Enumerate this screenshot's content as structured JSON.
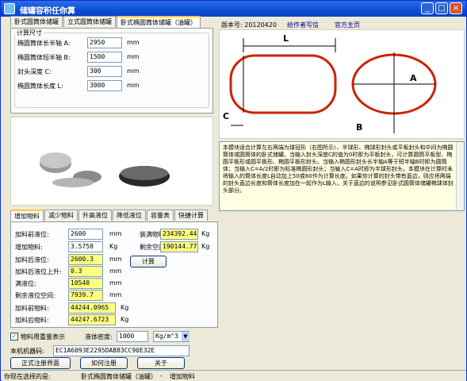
{
  "window": {
    "title": "储罐容积任你算"
  },
  "titlebar_buttons": {
    "minimize": "_",
    "maximize": "□",
    "close": "×"
  },
  "top_tabs": [
    "卧式圆筒体储罐",
    "立式圆筒体储罐",
    "卧式椭圆筒体储罐（油罐）"
  ],
  "calc": {
    "legend": "计算尺寸",
    "rows": [
      {
        "label": "椭圆筒体长半轴 A:",
        "value": "2950",
        "unit": "mm"
      },
      {
        "label": "椭圆筒体短半轴 B:",
        "value": "1500",
        "unit": "mm"
      },
      {
        "label": "封头深度 C:",
        "value": "300",
        "unit": "mm"
      },
      {
        "label": "椭圆筒体长度 L:",
        "value": "3000",
        "unit": "mm"
      }
    ]
  },
  "header": {
    "version": "版本号: 20120420",
    "link_feedback": "给作者写信",
    "link_home": "官方主页"
  },
  "diagram": {
    "label_L": "L",
    "label_C": "C",
    "label_A": "A",
    "label_B": "B"
  },
  "description": "本模块适合计算左右两端为球冠形（右图所示）、半球形、椭球形封头或平板封头和中间为椭圆筒体或圆筒体的卧式储罐。当输入封头深度C的值为0时即为平板封头，可计算圆筒平板型、椭圆平板形或圆平板形、椭圆平板形封头。当输入椭圆形封头长半轴A等于短半轴B时即为圆筒体；当输入C=A/2时即为标准椭圆形封头；当输入C=A时即为半球形封头。本模块在计算时未将输入的筒体长度L自动加上50或80作为计算长度。如果你计算的封头带有直边，则应将两端的封头直边长度和筒体长度加在一起作为L输入，关于直边的说明参见卧式圆筒体储罐椭球体封头部分。",
  "bottom_tabs": [
    "增加物料",
    "减少物料",
    "升高液位",
    "降低液位",
    "容量表",
    "快捷计算"
  ],
  "add": {
    "before_level": {
      "label": "加料前液位:",
      "value": "2600",
      "unit": "mm"
    },
    "add_amount": {
      "label": "增加物料:",
      "value": "3.5758",
      "unit": "Kg"
    },
    "after_level": {
      "label": "加料后液位:",
      "value": "2600.3",
      "unit": "mm"
    },
    "level_rise": {
      "label": "加料后液位上升:",
      "value": "0.3",
      "unit": "mm"
    },
    "full_level": {
      "label": "满液位:",
      "value": "10540",
      "unit": "mm"
    },
    "remaining_space": {
      "label": "剩余液位空间:",
      "value": "7939.7",
      "unit": "mm"
    },
    "before_material": {
      "label": "加料前物料:",
      "value": "44244.0965",
      "unit": "Kg"
    },
    "after_material": {
      "label": "加料后物料:",
      "value": "44247.6723",
      "unit": "Kg"
    },
    "loaded": {
      "label": "装满物料:",
      "value": "234392.447",
      "unit": "Kg"
    },
    "remaining": {
      "label": "剩余空间:",
      "value": "190144.775",
      "unit": "Kg"
    },
    "calc_button": "计算"
  },
  "weight": {
    "checkbox_label": "物料用重量表示",
    "checked": true,
    "density_label": "液体密度:",
    "density_value": "1000",
    "density_unit": "Kg/m^3"
  },
  "machine": {
    "label": "本机机器码:",
    "code": "EC1A6093E2295DAB83CC90E32E"
  },
  "buttons": {
    "register_ui": "正式注册界面",
    "how_register": "如何注册",
    "about": "关于"
  },
  "status": {
    "prefix": "你现在选择的是:",
    "selection": "卧式椭圆筒体储罐（油罐）",
    "separator": "-",
    "mode": "增加物料"
  },
  "colors": {
    "titlebar": "#0a4fd9",
    "tank_outline": "#cc2200",
    "yellow_field": "#ffff80",
    "link": "#00008b"
  }
}
